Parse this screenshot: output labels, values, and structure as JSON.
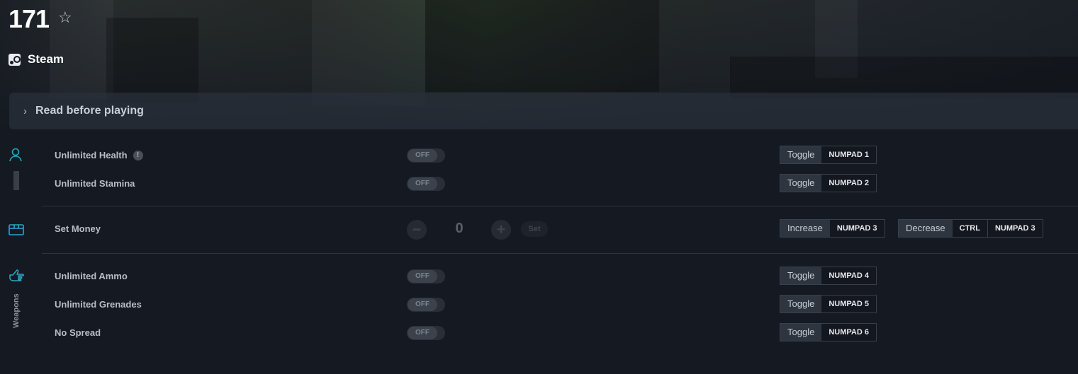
{
  "game": {
    "title": "171",
    "platform": "Steam"
  },
  "readbar": {
    "label": "Read before playing"
  },
  "categories": {
    "weapons_label": "Weapons"
  },
  "cheats": {
    "unlimited_health": {
      "label": "Unlimited Health",
      "state": "OFF",
      "action": "Toggle",
      "key": "NUMPAD 1"
    },
    "unlimited_stamina": {
      "label": "Unlimited Stamina",
      "state": "OFF",
      "action": "Toggle",
      "key": "NUMPAD 2"
    },
    "set_money": {
      "label": "Set Money",
      "value": "0",
      "set_label": "Set",
      "increase_label": "Increase",
      "increase_key": "NUMPAD 3",
      "decrease_label": "Decrease",
      "decrease_mod": "CTRL",
      "decrease_key": "NUMPAD 3"
    },
    "unlimited_ammo": {
      "label": "Unlimited Ammo",
      "state": "OFF",
      "action": "Toggle",
      "key": "NUMPAD 4"
    },
    "unlimited_grenades": {
      "label": "Unlimited Grenades",
      "state": "OFF",
      "action": "Toggle",
      "key": "NUMPAD 5"
    },
    "no_spread": {
      "label": "No Spread",
      "state": "OFF",
      "action": "Toggle",
      "key": "NUMPAD 6"
    }
  },
  "colors": {
    "accent": "#2aa7c9",
    "background": "#151a22"
  }
}
